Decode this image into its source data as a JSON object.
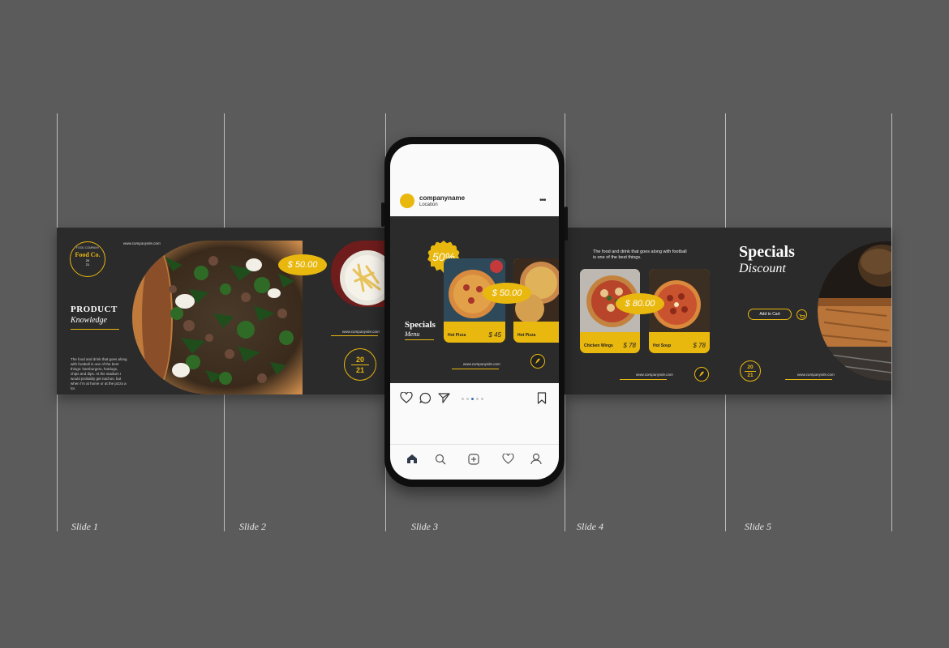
{
  "slides": [
    "Slide 1",
    "Slide 2",
    "Slide 3",
    "Slide 4",
    "Slide 5"
  ],
  "colors": {
    "background": "#5b5b5b",
    "strip": "#2b2b2b",
    "accent": "#e9b80f",
    "text": "#ffffff"
  },
  "slide1": {
    "logo_top": "FOOD COMPANY",
    "logo_name": "Food Co.",
    "logo_year_top": "20",
    "logo_year_bottom": "21",
    "website": "www.companysite.com",
    "heading": "PRODUCT",
    "subheading": "Knowledge",
    "body": "The food and drink that goes along with football is one of the best things: hamburgers, hotdogs, chips and dips. At the stadium I would probably get nachos, but when I'm at home or at the pizza a lot."
  },
  "slide2": {
    "price": "$ 50.00",
    "website": "www.companysite.com",
    "year_top": "20",
    "year_bottom": "21"
  },
  "phone": {
    "username": "companyname",
    "location": "Location",
    "more_icon": "more-icon",
    "post": {
      "discount": "50%",
      "price": "$ 50.00",
      "title": "Specials",
      "subtitle": "Menu",
      "website": "www.companysite.com",
      "card1_label": "Hot Pizza",
      "card1_price": "$ 45",
      "card2_label": "Hot Pizza"
    },
    "actions": [
      "heart-icon",
      "comment-icon",
      "share-icon",
      "bookmark-icon"
    ],
    "carousel_dots": 5,
    "carousel_active": 3,
    "nav": [
      "home-icon",
      "search-icon",
      "add-icon",
      "heart-icon",
      "profile-icon"
    ]
  },
  "slide4": {
    "text": "The food and drink that goes along with football is one of the best things.",
    "price": "$ 80.00",
    "card1_label": "Chicken Wings",
    "card1_price": "$ 78",
    "card2_label": "Hot Soup",
    "card2_price": "$ 78",
    "website": "www.companysite.com"
  },
  "slide5": {
    "title": "Specials",
    "subtitle": "Discount",
    "button": "Add to Cart",
    "cart_icon": "cart-icon",
    "year_top": "20",
    "year_bottom": "21",
    "website": "www.companysite.com"
  }
}
